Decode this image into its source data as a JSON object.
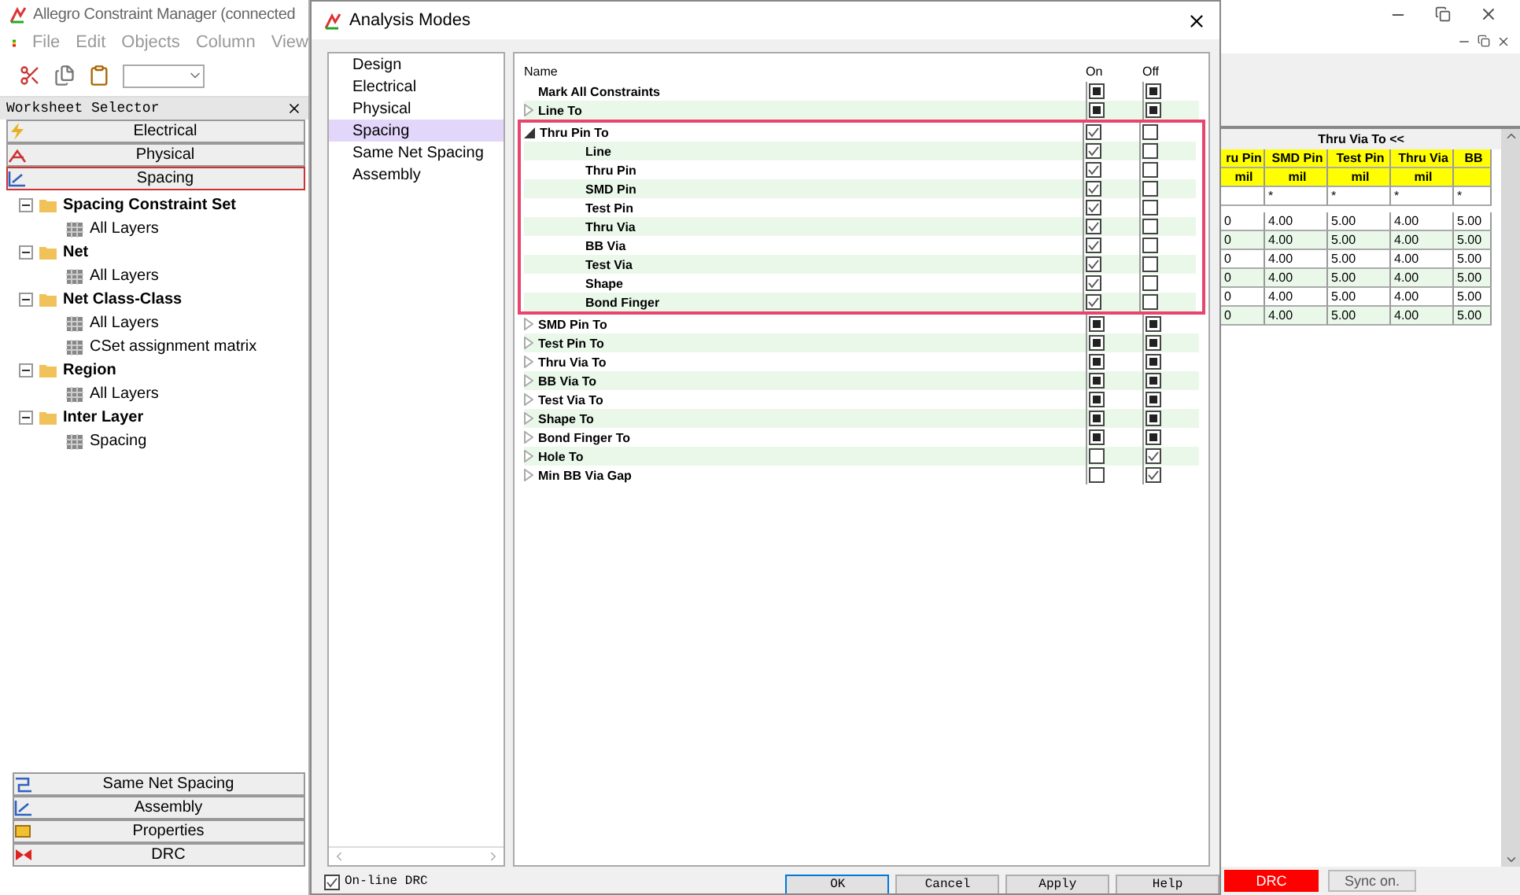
{
  "app": {
    "title": "Allegro Constraint Manager (connected",
    "menu": [
      "File",
      "Edit",
      "Objects",
      "Column",
      "View"
    ],
    "worksheet_selector": {
      "title": "Worksheet Selector",
      "tabs": [
        {
          "label": "Electrical",
          "kind": "electrical",
          "selected": false
        },
        {
          "label": "Physical",
          "kind": "physical",
          "selected": false
        },
        {
          "label": "Spacing",
          "kind": "spacing",
          "selected": true
        }
      ],
      "tree": [
        {
          "label": "Spacing Constraint Set",
          "expanded": true,
          "children": [
            {
              "label": "All Layers"
            }
          ]
        },
        {
          "label": "Net",
          "expanded": true,
          "children": [
            {
              "label": "All Layers"
            }
          ]
        },
        {
          "label": "Net Class-Class",
          "expanded": true,
          "children": [
            {
              "label": "All Layers"
            },
            {
              "label": "CSet assignment matrix"
            }
          ]
        },
        {
          "label": "Region",
          "expanded": true,
          "children": [
            {
              "label": "All Layers"
            }
          ]
        },
        {
          "label": "Inter Layer",
          "expanded": true,
          "children": [
            {
              "label": "Spacing"
            }
          ]
        }
      ],
      "bottom_tabs": [
        {
          "label": "Same Net Spacing",
          "kind": "samenet"
        },
        {
          "label": "Assembly",
          "kind": "spacing"
        },
        {
          "label": "Properties",
          "kind": "properties"
        },
        {
          "label": "DRC",
          "kind": "drc"
        }
      ]
    },
    "worksheet": {
      "title": "Thru Via To <<",
      "columns": [
        "ru Pin",
        "SMD Pin",
        "Test Pin",
        "Thru Via",
        "BB"
      ],
      "units": [
        "mil",
        "mil",
        "mil",
        "mil"
      ],
      "filter_row": [
        "*",
        "*",
        "*",
        "*"
      ],
      "rows": [
        [
          "0",
          "4.00",
          "5.00",
          "4.00",
          "5.00"
        ],
        [
          "0",
          "4.00",
          "5.00",
          "4.00",
          "5.00"
        ],
        [
          "0",
          "4.00",
          "5.00",
          "4.00",
          "5.00"
        ],
        [
          "0",
          "4.00",
          "5.00",
          "4.00",
          "5.00"
        ],
        [
          "0",
          "4.00",
          "5.00",
          "4.00",
          "5.00"
        ],
        [
          "0",
          "4.00",
          "5.00",
          "4.00",
          "5.00"
        ]
      ]
    },
    "status": {
      "drc": "DRC",
      "sync": "Sync on."
    }
  },
  "dialog": {
    "title": "Analysis Modes",
    "categories": [
      {
        "label": "Design",
        "selected": false
      },
      {
        "label": "Electrical",
        "selected": false
      },
      {
        "label": "Physical",
        "selected": false
      },
      {
        "label": "Spacing",
        "selected": true
      },
      {
        "label": "Same Net Spacing",
        "selected": false
      },
      {
        "label": "Assembly",
        "selected": false
      }
    ],
    "columns": [
      "Name",
      "On",
      "Off"
    ],
    "rows": [
      {
        "name": "Mark All Constraints",
        "on_checked": false,
        "on_partial": true,
        "off_checked": false,
        "off_partial": true
      },
      {
        "name": "Line To",
        "expanded": false,
        "on_checked": false,
        "on_partial": true,
        "off_checked": false,
        "off_partial": true
      },
      {
        "name": "Thru Pin To",
        "expanded": true,
        "highlighted": true,
        "on_checked": true,
        "on_partial": false,
        "off_checked": false,
        "off_partial": false,
        "children": [
          {
            "name": "Line",
            "on_checked": true,
            "on_partial": false,
            "off_checked": false,
            "off_partial": false
          },
          {
            "name": "Thru Pin",
            "on_checked": true,
            "on_partial": false,
            "off_checked": false,
            "off_partial": false
          },
          {
            "name": "SMD Pin",
            "on_checked": true,
            "on_partial": false,
            "off_checked": false,
            "off_partial": false
          },
          {
            "name": "Test Pin",
            "on_checked": true,
            "on_partial": false,
            "off_checked": false,
            "off_partial": false
          },
          {
            "name": "Thru Via",
            "on_checked": true,
            "on_partial": false,
            "off_checked": false,
            "off_partial": false
          },
          {
            "name": "BB Via",
            "on_checked": true,
            "on_partial": false,
            "off_checked": false,
            "off_partial": false
          },
          {
            "name": "Test Via",
            "on_checked": true,
            "on_partial": false,
            "off_checked": false,
            "off_partial": false
          },
          {
            "name": "Shape",
            "on_checked": true,
            "on_partial": false,
            "off_checked": false,
            "off_partial": false
          },
          {
            "name": "Bond Finger",
            "on_checked": true,
            "on_partial": false,
            "off_checked": false,
            "off_partial": false
          }
        ]
      },
      {
        "name": "SMD Pin To",
        "expanded": false,
        "on_checked": false,
        "on_partial": true,
        "off_checked": false,
        "off_partial": true
      },
      {
        "name": "Test Pin To",
        "expanded": false,
        "on_checked": false,
        "on_partial": true,
        "off_checked": false,
        "off_partial": true
      },
      {
        "name": "Thru Via To",
        "expanded": false,
        "on_checked": false,
        "on_partial": true,
        "off_checked": false,
        "off_partial": true
      },
      {
        "name": "BB Via To",
        "expanded": false,
        "on_checked": false,
        "on_partial": true,
        "off_checked": false,
        "off_partial": true
      },
      {
        "name": "Test Via To",
        "expanded": false,
        "on_checked": false,
        "on_partial": true,
        "off_checked": false,
        "off_partial": true
      },
      {
        "name": "Shape To",
        "expanded": false,
        "on_checked": false,
        "on_partial": true,
        "off_checked": false,
        "off_partial": true
      },
      {
        "name": "Bond Finger To",
        "expanded": false,
        "on_checked": false,
        "on_partial": true,
        "off_checked": false,
        "off_partial": true
      },
      {
        "name": "Hole To",
        "expanded": false,
        "on_checked": false,
        "on_partial": false,
        "off_checked": true,
        "off_partial": false
      },
      {
        "name": "Min BB Via Gap",
        "expanded": false,
        "on_checked": false,
        "on_partial": false,
        "off_checked": true,
        "off_partial": false
      }
    ],
    "online_drc": {
      "label": "On-line DRC",
      "checked": true
    },
    "buttons": [
      {
        "label": "OK",
        "default": true
      },
      {
        "label": "Cancel",
        "default": false
      },
      {
        "label": "Apply",
        "default": false
      },
      {
        "label": "Help",
        "default": false
      }
    ]
  }
}
